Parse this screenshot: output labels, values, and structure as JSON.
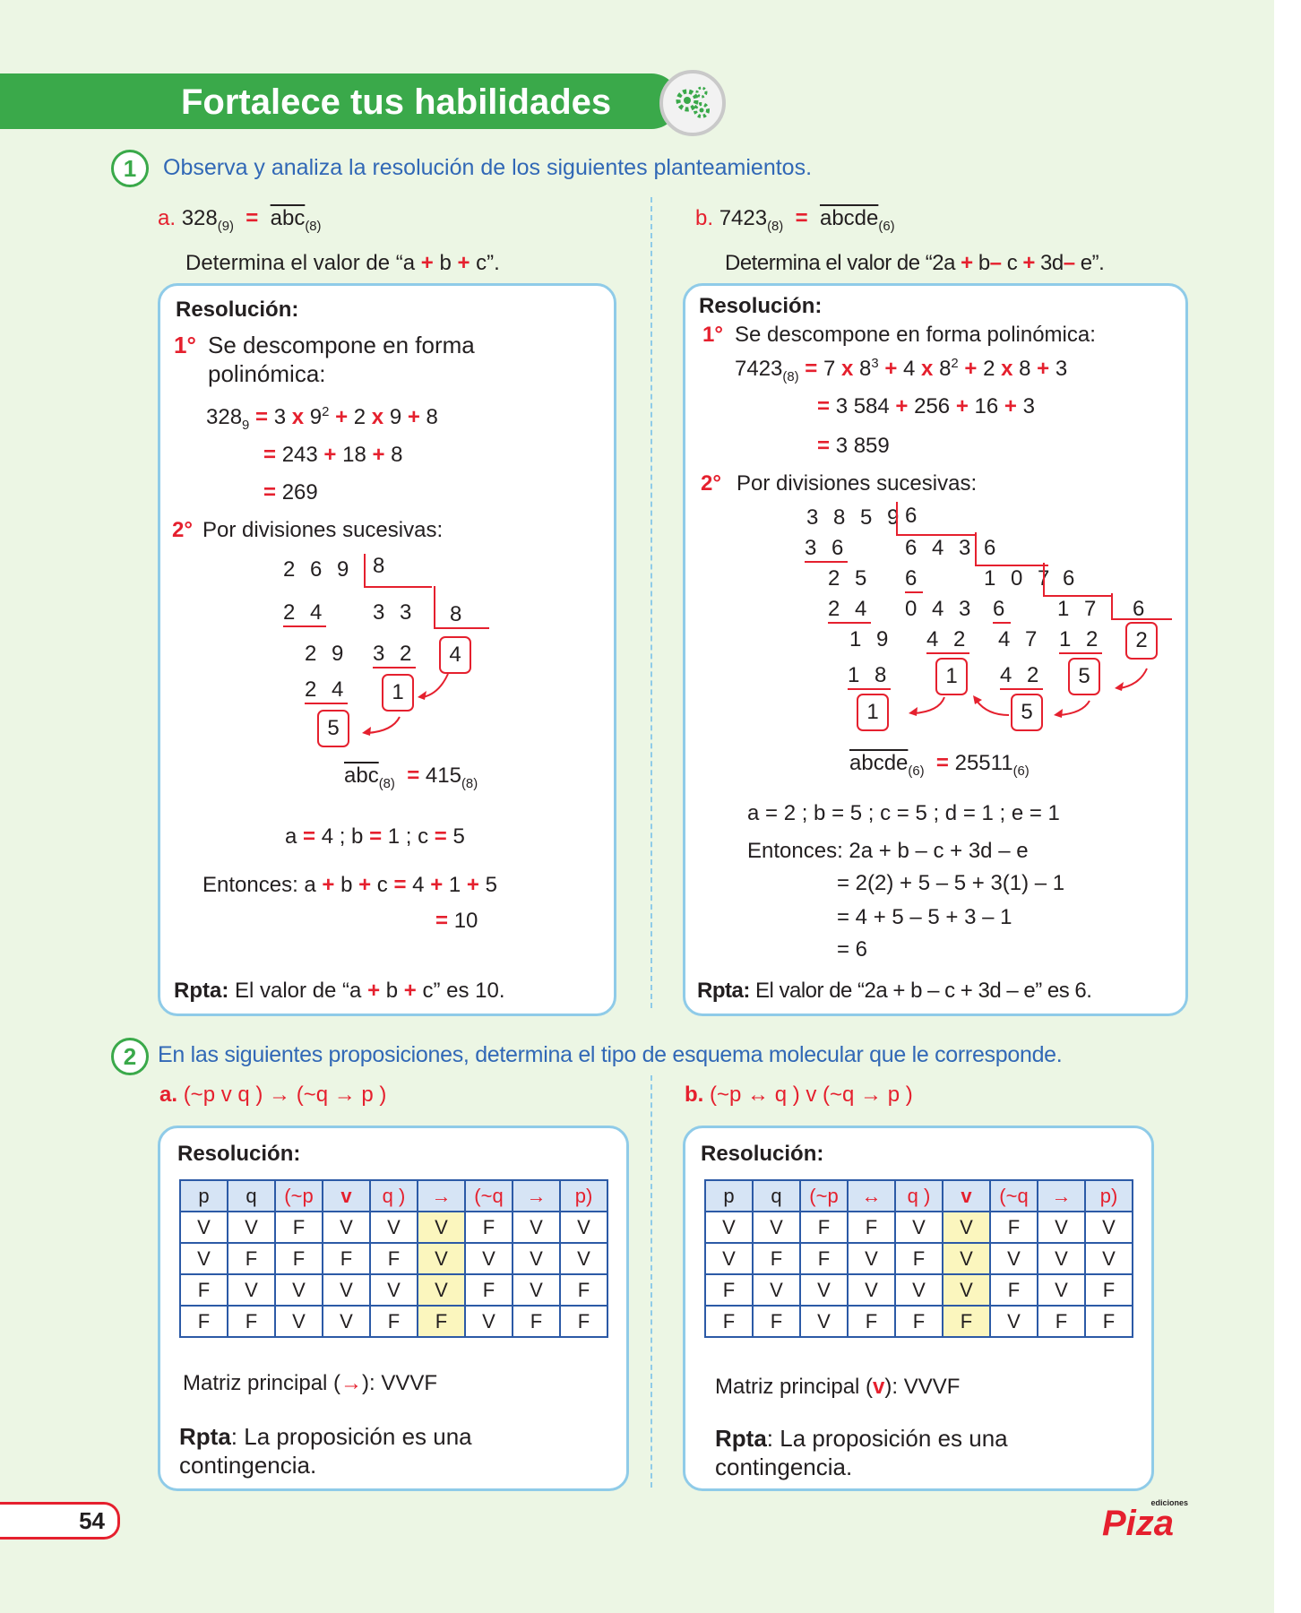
{
  "header": {
    "title": "Fortalece tus habilidades",
    "badge_icon": "gears-icon"
  },
  "q1": {
    "number": "1",
    "prompt": "Observa y analiza la resolución de los siguientes planteamientos.",
    "a": {
      "label": "a.",
      "eq_lhs": "328",
      "eq_lhs_base": "(9)",
      "eq_sign": "=",
      "eq_rhs": "abc",
      "eq_rhs_base": "(8)",
      "task_pre": "Determina el valor de “a ",
      "task_b": " b ",
      "task_post": " c”.",
      "resolution_label": "Resolución:",
      "step1_num": "1°",
      "step1_text_l1": "Se descompone en forma",
      "step1_text_l2": "polinómica:",
      "poly_l1_lhs": "328",
      "poly_l1_base": "9",
      "poly_l1_a": "3",
      "poly_l1_b": "9",
      "poly_l1_exp": "2",
      "poly_l1_c": "2",
      "poly_l1_d": "9",
      "poly_l1_e": "8",
      "poly_l2_a": "243",
      "poly_l2_b": "18",
      "poly_l2_c": "8",
      "poly_l3": "269",
      "step2_num": "2°",
      "step2_text": "Por divisiones sucesivas:",
      "div": {
        "n1": "2 6 9",
        "d1": "8",
        "s1": "2 4",
        "q1": "3 3",
        "d2": "8",
        "r1": "2 9",
        "s2": "3 2",
        "q2": "4",
        "s3": "2 4",
        "r2": "1",
        "r3": "5"
      },
      "result_lhs": "abc",
      "result_lhs_base": "(8)",
      "result_rhs": "415",
      "result_rhs_base": "(8)",
      "values_a": "a ",
      "values_a_val": " 4  ;  b ",
      "values_b_val": " 1 ;   c ",
      "values_c_val": " 5",
      "then_pre": "Entonces: a ",
      "then_b": " b ",
      "then_c": " c ",
      "then_eq": " 4 ",
      "then_1": " 1 ",
      "then_5": " 5",
      "then_result": "10",
      "answer_label": "Rpta:",
      "answer_pre": " El valor de “a ",
      "answer_mid": " b ",
      "answer_post": " c” es 10."
    },
    "b": {
      "label": "b.",
      "eq_lhs": "7423",
      "eq_lhs_base": "(8)",
      "eq_sign": "=",
      "eq_rhs": "abcde",
      "eq_rhs_base": "(6)",
      "task_1": "Determina el valor de “2a ",
      "task_2": " b",
      "task_3": " c ",
      "task_4": " 3d",
      "task_5": " e”.",
      "resolution_label": "Resolución:",
      "step1_num": "1°",
      "step1_text": "Se descompone en forma polinómica:",
      "poly_l1_lhs": "7423",
      "poly_l1_base": "(8)",
      "poly_l1": [
        "7",
        "8",
        "3",
        "4",
        "8",
        "2",
        "2",
        "8",
        "3"
      ],
      "poly_l2": [
        "3 584",
        "256",
        "16",
        "3"
      ],
      "poly_l3": "3 859",
      "step2_num": "2°",
      "step2_text": "Por divisiones sucesivas:",
      "div": {
        "n1": "3 8 5 9",
        "d1": "6",
        "s1": "3 6",
        "q1": "6 4 3",
        "d2": "6",
        "r1": "2 5",
        "s1b": "6",
        "q2": "1 0 7",
        "d3": "6",
        "s2": "2 4",
        "r2": "0 4 3",
        "s3": "6",
        "q3": "1 7",
        "d4": "6",
        "r3": "1 9",
        "s4": "4 2",
        "r4": "4 7",
        "s5": "1 2",
        "q4": "2",
        "s6": "1 8",
        "r5": "1",
        "s7": "4 2",
        "r6": "5",
        "r7": "1",
        "r8": "5"
      },
      "result_lhs": "abcde",
      "result_lhs_base": "(6)",
      "result_rhs": "25511",
      "result_rhs_base": "(6)",
      "values": "a = 2  ;  b = 5 ;   c = 5 ;   d = 1 ;   e = 1",
      "then_line": "Entonces: 2a + b – c + 3d – e",
      "calc_l1": "= 2(2) + 5 – 5 + 3(1) – 1",
      "calc_l2": "= 4 + 5 – 5 + 3 – 1",
      "calc_l3": "= 6",
      "answer_label": "Rpta:",
      "answer_text": " El valor de “2a + b – c + 3d – e” es 6."
    }
  },
  "q2": {
    "number": "2",
    "prompt": "En las siguientes proposiciones, determina el tipo de esquema molecular que le corresponde.",
    "a": {
      "label": "a.",
      "formula": "(~p v q ) → (~q → p )",
      "resolution_label": "Resolución:",
      "headers": [
        "p",
        "q",
        "(~p",
        "v",
        "q )",
        "→",
        "(~q",
        "→",
        "p)"
      ],
      "rows": [
        [
          "V",
          "V",
          "F",
          "V",
          "V",
          "V",
          "F",
          "V",
          "V"
        ],
        [
          "V",
          "F",
          "F",
          "F",
          "F",
          "V",
          "V",
          "V",
          "V"
        ],
        [
          "F",
          "V",
          "V",
          "V",
          "V",
          "V",
          "F",
          "V",
          "F"
        ],
        [
          "F",
          "F",
          "V",
          "V",
          "F",
          "F",
          "V",
          "F",
          "F"
        ]
      ],
      "matrix_label": "Matriz principal (",
      "matrix_symbol": "→",
      "matrix_value": "): VVVF",
      "answer_label": "Rpta",
      "answer_l1": ": La proposición es una",
      "answer_l2": "contingencia."
    },
    "b": {
      "label": "b.",
      "formula": "(~p ↔ q ) v (~q → p )",
      "resolution_label": "Resolución:",
      "headers": [
        "p",
        "q",
        "(~p",
        "↔",
        "q )",
        "v",
        "(~q",
        "→",
        "p)"
      ],
      "rows": [
        [
          "V",
          "V",
          "F",
          "F",
          "V",
          "V",
          "F",
          "V",
          "V"
        ],
        [
          "V",
          "F",
          "F",
          "V",
          "F",
          "V",
          "V",
          "V",
          "V"
        ],
        [
          "F",
          "V",
          "V",
          "V",
          "V",
          "V",
          "F",
          "V",
          "F"
        ],
        [
          "F",
          "F",
          "V",
          "F",
          "F",
          "F",
          "V",
          "F",
          "F"
        ]
      ],
      "matrix_label": "Matriz principal (",
      "matrix_symbol": "v",
      "matrix_value": "): VVVF",
      "answer_label": "Rpta",
      "answer_l1": ": La proposición es una",
      "answer_l2": "contingencia."
    }
  },
  "footer": {
    "page_number": "54",
    "logo_small": "ediciones",
    "logo": "Piza"
  },
  "colors": {
    "green": "#3aa94a",
    "red": "#e5202e",
    "blue": "#3168b6",
    "box_border": "#8fcbe8",
    "page_bg": "#ecf6e4"
  }
}
